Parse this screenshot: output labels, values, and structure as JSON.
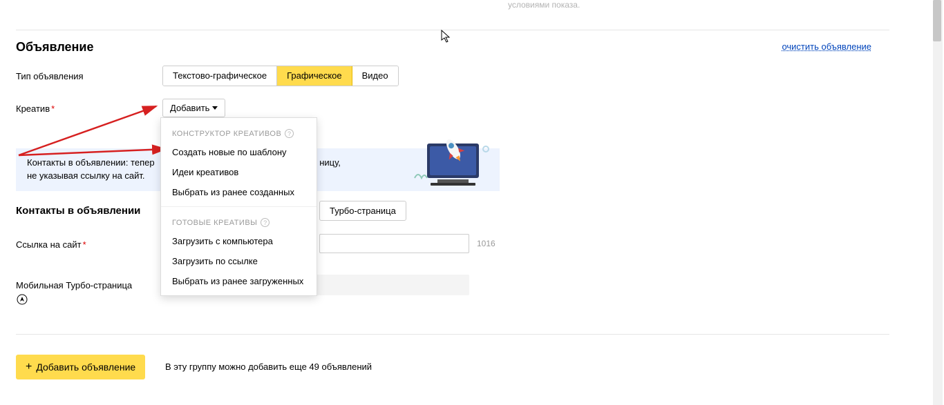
{
  "top_hint": "условиями показа.",
  "section": {
    "title": "Объявление",
    "clear": "очистить объявление"
  },
  "labels": {
    "ad_type": "Тип объявления",
    "creative": "Креатив",
    "site_link": "Ссылка на сайт",
    "mobile_turbo": "Мобильная Турбо-страница"
  },
  "toggle": {
    "text": "Текстово-графическое",
    "graphic": "Графическое",
    "video": "Видео"
  },
  "add_btn": "Добавить",
  "dropdown": {
    "group1": "КОНСТРУКТОР КРЕАТИВОВ",
    "item1": "Создать новые по шаблону",
    "item2": "Идеи креативов",
    "item3": "Выбрать из ранее созданных",
    "group2": "ГОТОВЫЕ КРЕАТИВЫ",
    "item4": "Загрузить с компьютера",
    "item5": "Загрузить по ссылке",
    "item6": "Выбрать из ранее загруженных"
  },
  "banner": {
    "line1a": "Контакты в объявлении: тепер",
    "line1b": "ницу,",
    "line2": "не указывая ссылку на сайт."
  },
  "subsection": "Контакты в объявлении",
  "turbo_btn": "Турбо-страница",
  "char_count": "1016",
  "add_ad": "Добавить объявление",
  "group_hint": "В эту группу можно добавить еще 49 объявлений"
}
